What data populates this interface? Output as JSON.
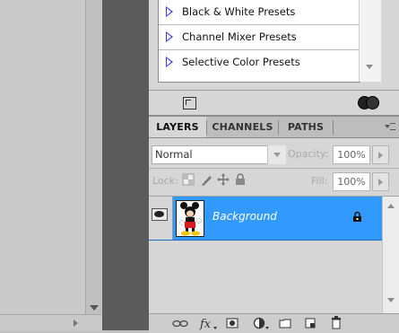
{
  "presets": {
    "items": [
      {
        "label": "Black & White Presets"
      },
      {
        "label": "Channel Mixer Presets"
      },
      {
        "label": "Selective Color Presets"
      }
    ]
  },
  "layers_panel": {
    "tabs": [
      {
        "label": "LAYERS",
        "active": true
      },
      {
        "label": "CHANNELS",
        "active": false
      },
      {
        "label": "PATHS",
        "active": false
      }
    ],
    "blend_mode": "Normal",
    "opacity_label": "Opacity:",
    "opacity_value": "100%",
    "lock_label": "Lock:",
    "fill_label": "Fill:",
    "fill_value": "100%",
    "layers": [
      {
        "name": "Background",
        "visible": true,
        "locked": true,
        "selected": true
      }
    ]
  },
  "colors": {
    "selection": "#3299ff",
    "panel": "#d6d6d6",
    "dark_gap": "#5b5b5b",
    "preset_arrow": "#3a3ae8"
  }
}
